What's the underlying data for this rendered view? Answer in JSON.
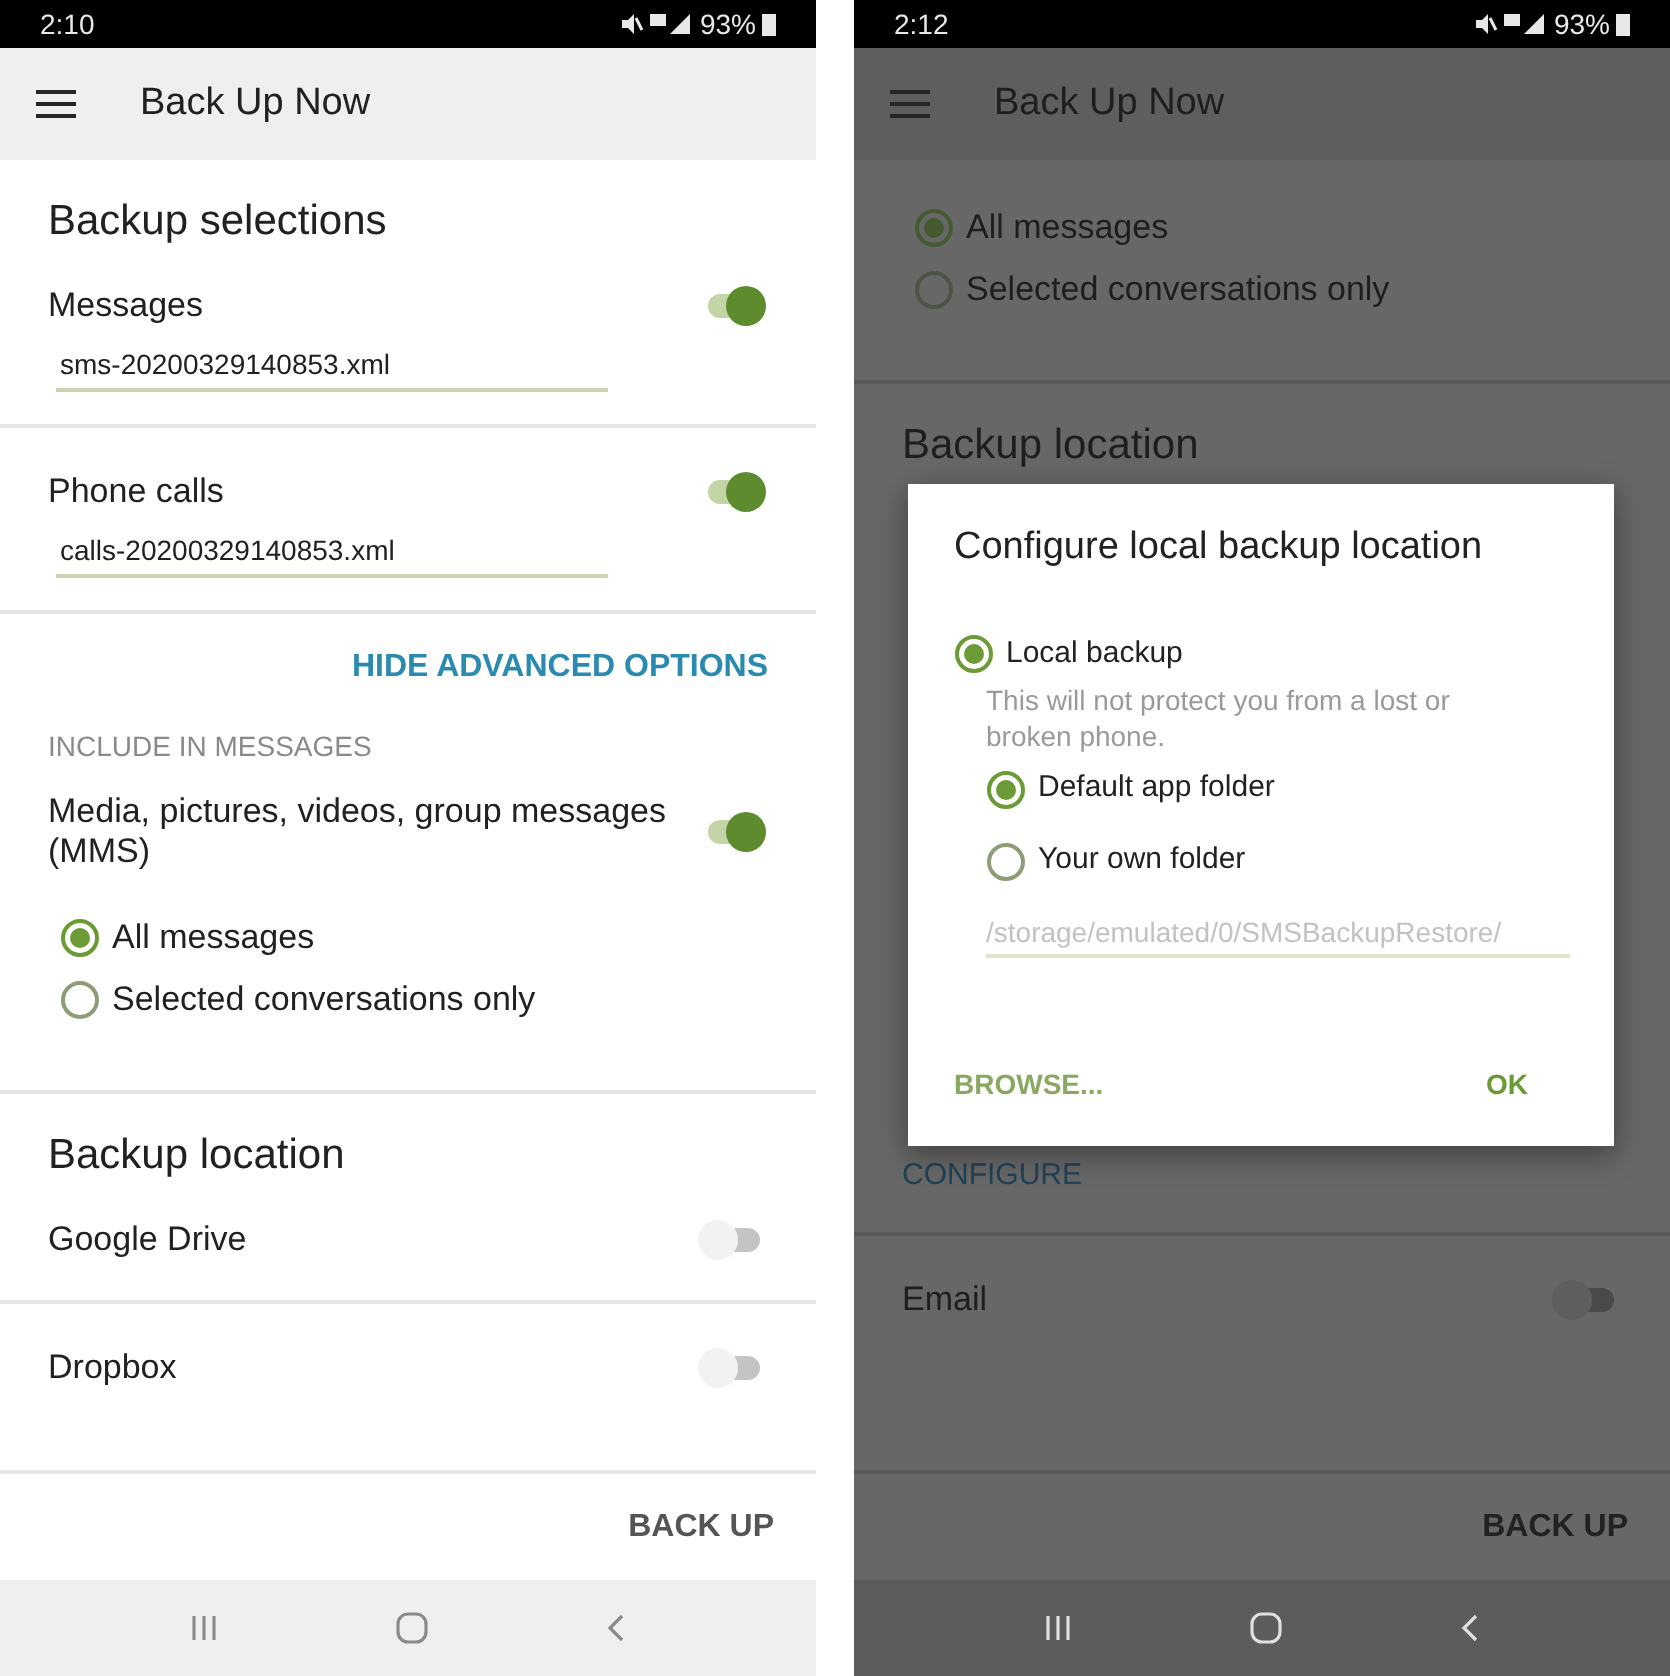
{
  "screens": [
    {
      "dimmed": false,
      "status_bar": {
        "time": "2:10",
        "battery": "93%"
      },
      "app_bar": {
        "title": "Back Up Now"
      },
      "blocks": [
        {
          "items": [
            {
              "kind": "heading",
              "text": "Backup selections"
            },
            {
              "kind": "toggle",
              "label": "Messages",
              "on": true,
              "field": "sms-20200329140853.xml"
            }
          ]
        },
        {
          "items": [
            {
              "kind": "toggle",
              "label": "Phone calls",
              "on": true,
              "field": "calls-20200329140853.xml"
            }
          ]
        },
        {
          "items": [
            {
              "kind": "link",
              "text": "HIDE ADVANCED OPTIONS"
            },
            {
              "kind": "caption",
              "text": "INCLUDE IN MESSAGES"
            },
            {
              "kind": "toggle",
              "label": "Media, pictures, videos, group messages (MMS)",
              "on": true
            },
            {
              "kind": "radios",
              "options": [
                {
                  "label": "All messages",
                  "selected": true
                },
                {
                  "label": "Selected conversations only",
                  "selected": false
                }
              ]
            }
          ]
        },
        {
          "items": [
            {
              "kind": "heading",
              "text": "Backup location"
            },
            {
              "kind": "toggle",
              "label": "Google Drive",
              "on": false
            }
          ]
        },
        {
          "items": [
            {
              "kind": "toggle",
              "label": "Dropbox",
              "on": false
            }
          ]
        }
      ],
      "action": "BACK UP"
    },
    {
      "dimmed": true,
      "status_bar": {
        "time": "2:12",
        "battery": "93%"
      },
      "app_bar": {
        "title": "Back Up Now"
      },
      "blocks": [
        {
          "items": [
            {
              "kind": "radios",
              "options": [
                {
                  "label": "All messages",
                  "selected": true
                },
                {
                  "label": "Selected conversations only",
                  "selected": false
                }
              ]
            }
          ]
        },
        {
          "items": [
            {
              "kind": "heading",
              "text": "Backup location"
            },
            {
              "kind": "action_link",
              "text": "CONFIGURE"
            }
          ]
        },
        {
          "items": [
            {
              "kind": "toggle",
              "label": "Email",
              "on": false
            }
          ]
        }
      ],
      "action": "BACK UP",
      "dialog": {
        "title": "Configure local backup location",
        "option": {
          "label": "Local backup",
          "selected": true
        },
        "note": "This will not protect you from a lost or broken phone.",
        "folders": [
          {
            "label": "Default app folder",
            "selected": true
          },
          {
            "label": "Your own folder",
            "selected": false
          }
        ],
        "path": {
          "value": "/storage/emulated/0/SMSBackupRestore/",
          "disabled": true
        },
        "buttons": [
          "BROWSE...",
          "OK"
        ]
      }
    }
  ]
}
